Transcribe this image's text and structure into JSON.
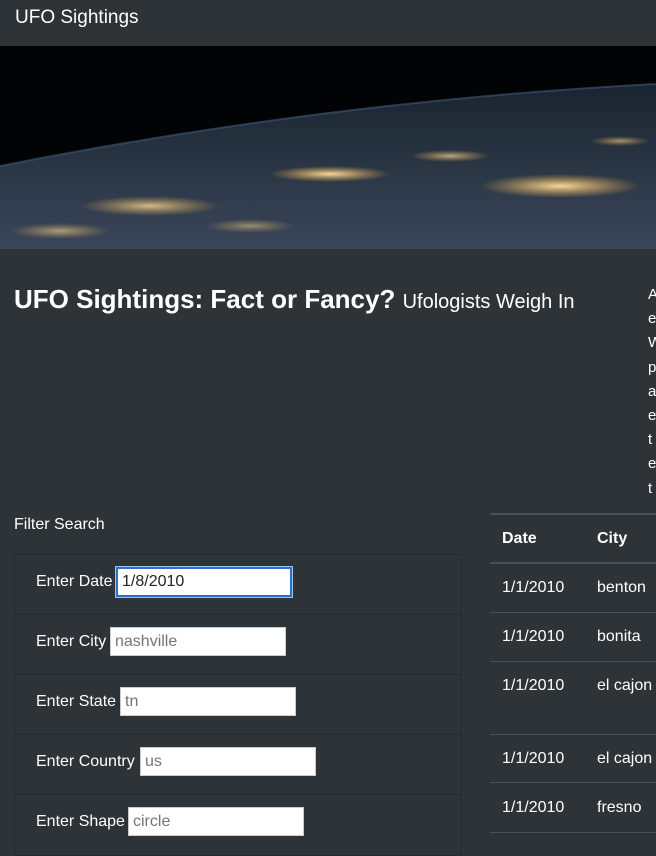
{
  "navbar": {
    "brand": "UFO Sightings"
  },
  "hero": {
    "image": "earth-from-space-night-lights"
  },
  "headline": {
    "title": "UFO Sightings: Fact or Fancy?",
    "subtitle": "Ufologists Weigh In"
  },
  "article": {
    "visible_letters": [
      "A",
      "e",
      "W",
      "p",
      "a",
      "e",
      "t",
      "e",
      "t"
    ]
  },
  "filter": {
    "title": "Filter Search",
    "fields": [
      {
        "label": "Enter Date",
        "value": "1/8/2010",
        "placeholder": ""
      },
      {
        "label": "Enter City",
        "value": "",
        "placeholder": "nashville"
      },
      {
        "label": "Enter State",
        "value": "",
        "placeholder": "tn"
      },
      {
        "label": "Enter Country",
        "value": "",
        "placeholder": "us"
      },
      {
        "label": "Enter Shape",
        "value": "",
        "placeholder": "circle"
      }
    ]
  },
  "table": {
    "headers": [
      "Date",
      "City"
    ],
    "rows": [
      {
        "date": "1/1/2010",
        "city": "benton"
      },
      {
        "date": "1/1/2010",
        "city": "bonita"
      },
      {
        "date": "1/1/2010",
        "city": "el cajon"
      },
      {
        "date": "1/1/2010",
        "city": "el cajon"
      },
      {
        "date": "1/1/2010",
        "city": "fresno"
      }
    ]
  }
}
